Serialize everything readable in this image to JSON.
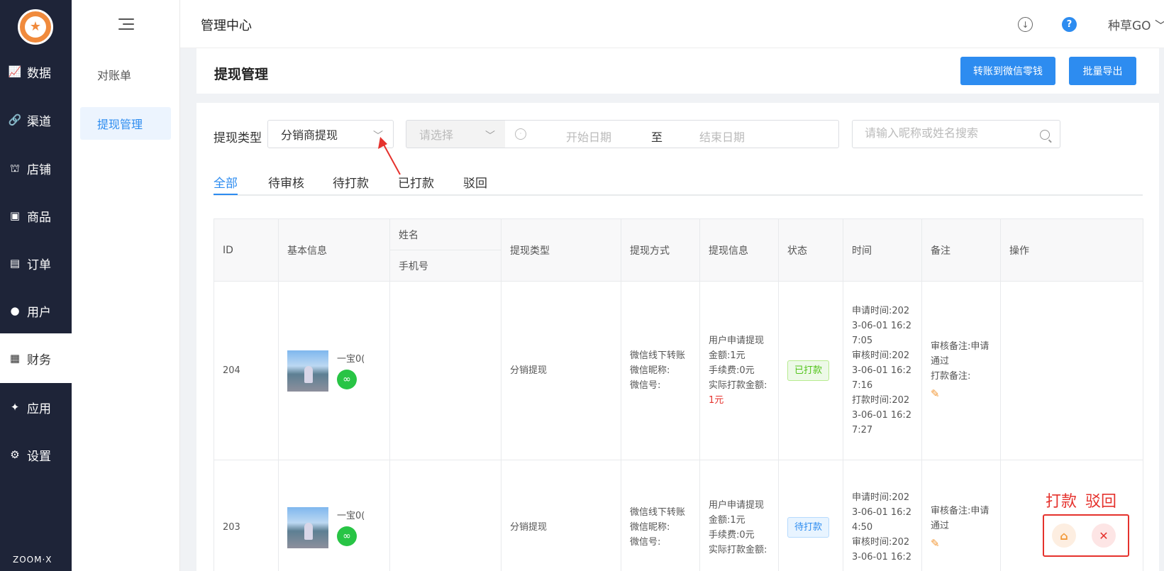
{
  "sidebar": {
    "brand": "ZOOM·X",
    "items": [
      {
        "label": "数据"
      },
      {
        "label": "渠道"
      },
      {
        "label": "店铺"
      },
      {
        "label": "商品"
      },
      {
        "label": "订单"
      },
      {
        "label": "用户"
      },
      {
        "label": "财务"
      },
      {
        "label": "应用"
      },
      {
        "label": "设置"
      }
    ]
  },
  "subnav": {
    "items": [
      {
        "label": "对账单"
      },
      {
        "label": "提现管理"
      }
    ]
  },
  "topbar": {
    "title": "管理中心",
    "user": "种草GO ﹀"
  },
  "page": {
    "title": "提现管理",
    "buttons": {
      "transfer": "转账到微信零钱",
      "export": "批量导出"
    }
  },
  "filters": {
    "type_label": "提现类型",
    "type_value": "分销商提现",
    "secondary_placeholder": "请选择",
    "date_start": "开始日期",
    "date_sep": "至",
    "date_end": "结束日期",
    "search_placeholder": "请输入昵称或姓名搜索"
  },
  "tabs": [
    {
      "label": "全部"
    },
    {
      "label": "待审核"
    },
    {
      "label": "待打款"
    },
    {
      "label": "已打款"
    },
    {
      "label": "驳回"
    }
  ],
  "table": {
    "headers": {
      "id": "ID",
      "basic": "基本信息",
      "name": "姓名",
      "phone": "手机号",
      "type": "提现类型",
      "method": "提现方式",
      "info": "提现信息",
      "status": "状态",
      "time": "时间",
      "remark": "备注",
      "ops": "操作"
    },
    "rows": [
      {
        "id": "204",
        "nickname": "一宝0(",
        "type": "分销提现",
        "method": [
          "微信线下转账",
          "微信昵称:",
          "微信号:"
        ],
        "info": [
          "用户申请提现",
          "金额:1元",
          "手续费:0元",
          "实际打款金额:",
          "1元"
        ],
        "status": "已打款",
        "time": [
          "申请时间:202",
          "3-06-01 16:2",
          "7:05",
          "审核时间:202",
          "3-06-01 16:2",
          "7:16",
          "打款时间:202",
          "3-06-01 16:2",
          "7:27"
        ],
        "remark": [
          "审核备注:申请",
          "通过",
          "打款备注:"
        ]
      },
      {
        "id": "203",
        "nickname": "一宝0(",
        "type": "分销提现",
        "method": [
          "微信线下转账",
          "微信昵称:",
          "微信号:"
        ],
        "info": [
          "用户申请提现",
          "金额:1元",
          "手续费:0元",
          "实际打款金额:"
        ],
        "status": "待打款",
        "time": [
          "申请时间:202",
          "3-06-01 16:2",
          "4:50",
          "审核时间:202",
          "3-06-01 16:2"
        ],
        "remark": [
          "审核备注:申请",
          "通过"
        ]
      }
    ]
  },
  "annotation": {
    "pay": "打款",
    "reject": "驳回"
  },
  "colors": {
    "primary": "#2d8cf0",
    "sidebar_bg": "#1e2438",
    "annotation": "#e5322d",
    "paid_green": "#52c41a",
    "edit_orange": "#f29837"
  }
}
